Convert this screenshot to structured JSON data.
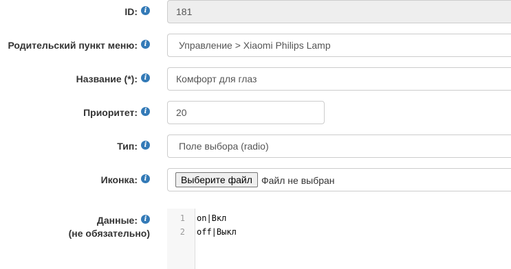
{
  "form": {
    "id": {
      "label": "ID:",
      "value": "181"
    },
    "parent_menu": {
      "label": "Родительский пункт меню:",
      "value": "Управление > Xiaomi Philips Lamp"
    },
    "title": {
      "label": "Название (*):",
      "value": "Комфорт для глаз"
    },
    "priority": {
      "label": "Приоритет:",
      "value": "20"
    },
    "type": {
      "label": "Тип:",
      "value": "Поле выбора (radio)"
    },
    "icon": {
      "label": "Иконка:",
      "button_label": "Выберите файл",
      "status": "Файл не выбран"
    },
    "data": {
      "label": "Данные:",
      "sublabel": "(не обязательно)",
      "lines": [
        {
          "number": "1",
          "text": "on|Вкл"
        },
        {
          "number": "2",
          "text": "off|Выкл"
        }
      ]
    }
  },
  "info_icon_glyph": "i",
  "colors": {
    "info_icon": "#337ab7",
    "readonly_bg": "#eeeeee",
    "border": "#cccccc"
  }
}
